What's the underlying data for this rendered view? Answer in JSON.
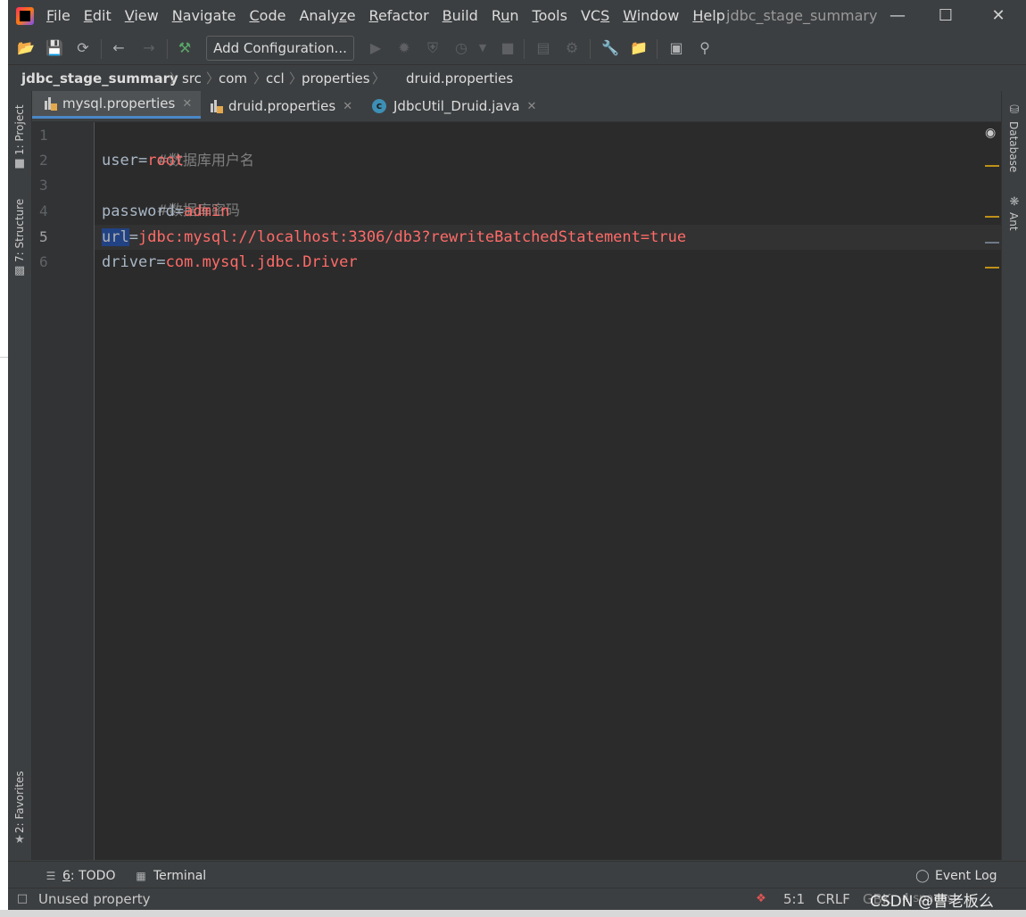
{
  "menu": {
    "items": [
      "File",
      "Edit",
      "View",
      "Navigate",
      "Code",
      "Analyze",
      "Refactor",
      "Build",
      "Run",
      "Tools",
      "VCS",
      "Window",
      "Help"
    ],
    "mnemonics": [
      "F",
      "E",
      "V",
      "N",
      "C",
      "z",
      "R",
      "B",
      "u",
      "T",
      "S",
      "W",
      "H"
    ],
    "window_title": "jdbc_stage_summary"
  },
  "toolbar": {
    "add_configuration": "Add Configuration..."
  },
  "breadcrumb": [
    "jdbc_stage_summary",
    "src",
    "com",
    "ccl",
    "properties",
    "druid.properties"
  ],
  "left_tools": {
    "project": "1: Project",
    "structure": "7: Structure",
    "favorites": "2: Favorites"
  },
  "right_tools": {
    "database": "Database",
    "ant": "Ant"
  },
  "tabs": [
    {
      "label": "mysql.properties",
      "type": "properties",
      "active": true
    },
    {
      "label": "druid.properties",
      "type": "properties",
      "active": false
    },
    {
      "label": "JdbcUtil_Druid.java",
      "type": "class",
      "active": false
    }
  ],
  "editor": {
    "lines": [
      {
        "num": "1",
        "comment": "#数据库用户名"
      },
      {
        "num": "2",
        "key": "user",
        "eq": "=",
        "value": "root"
      },
      {
        "num": "3",
        "comment": "#数据库密码"
      },
      {
        "num": "4",
        "key": "password",
        "eq": "=",
        "value": "admin"
      },
      {
        "num": "5",
        "key": "url",
        "eq": "=",
        "value": "jdbc:mysql://localhost:3306/db3?rewriteBatchedStatement=true"
      },
      {
        "num": "6",
        "key": "driver",
        "eq": "=",
        "value": "com.mysql.jdbc.Driver"
      }
    ],
    "current_line": 5
  },
  "bottom_tools": {
    "todo_num": "6",
    "todo_label": ": TODO",
    "terminal": "Terminal",
    "event_log": "Event Log"
  },
  "status": {
    "message": "Unused property",
    "position": "5:1",
    "line_sep": "CRLF",
    "encoding": "GBK",
    "indent": "4 spaces"
  },
  "watermark": "CSDN @曹老板么",
  "colors": {
    "background": "#2b2b2b",
    "panel": "#3c3f41",
    "key": "#cc7832",
    "value": "#ff6b68",
    "comment": "#808080",
    "accent": "#4a88c7"
  }
}
